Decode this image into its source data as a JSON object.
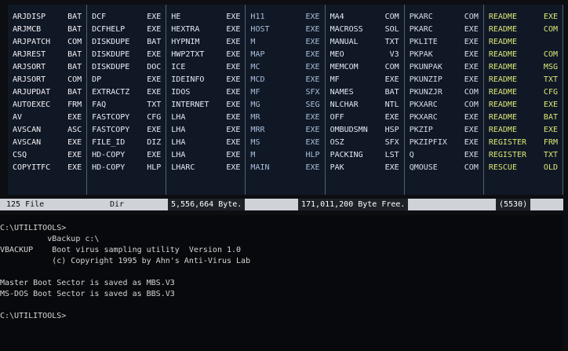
{
  "file_columns": [
    {
      "color": "#f4f1f5",
      "files": [
        [
          "ARJDISP",
          "BAT"
        ],
        [
          "ARJMCB",
          "BAT"
        ],
        [
          "ARJPATCH",
          "COM"
        ],
        [
          "ARJREST",
          "BAT"
        ],
        [
          "ARJSORT",
          "BAT"
        ],
        [
          "ARJSORT",
          "COM"
        ],
        [
          "ARJUPDAT",
          "BAT"
        ],
        [
          "AUTOEXEC",
          "FRM"
        ],
        [
          "AV",
          "EXE"
        ],
        [
          "AVSCAN",
          "ASC"
        ],
        [
          "AVSCAN",
          "EXE"
        ],
        [
          "CSQ",
          "EXE"
        ],
        [
          "COPYITFC",
          "EXE"
        ]
      ]
    },
    {
      "color": "#e9ecf5",
      "files": [
        [
          "DCF",
          "EXE"
        ],
        [
          "DCFHELP",
          "EXE"
        ],
        [
          "DISKDUPE",
          "BAT"
        ],
        [
          "DISKDUPE",
          "EXE"
        ],
        [
          "DISKDUPE",
          "DOC"
        ],
        [
          "DP",
          "EXE"
        ],
        [
          "EXTRACTZ",
          "EXE"
        ],
        [
          "FAQ",
          "TXT"
        ],
        [
          "FASTCOPY",
          "CFG"
        ],
        [
          "FASTCOPY",
          "EXE"
        ],
        [
          "FILE_ID",
          "DIZ"
        ],
        [
          "HD-COPY",
          "EXE"
        ],
        [
          "HD-COPY",
          "HLP"
        ]
      ]
    },
    {
      "color": "#e4e8f2",
      "files": [
        [
          "HE",
          "EXE"
        ],
        [
          "HEXTRA",
          "EXE"
        ],
        [
          "HYPNIM",
          "EXE"
        ],
        [
          "HWP2TXT",
          "EXE"
        ],
        [
          "ICE",
          "EXE"
        ],
        [
          "IDEINFO",
          "EXE"
        ],
        [
          "IDOS",
          "EXE"
        ],
        [
          "INTERNET",
          "EXE"
        ],
        [
          "LHA",
          "EXE"
        ],
        [
          "LHA",
          "EXE"
        ],
        [
          "LHA",
          "EXE"
        ],
        [
          "LHA",
          "EXE"
        ],
        [
          "LHARC",
          "EXE"
        ]
      ]
    },
    {
      "color": "#a9bfd9",
      "files": [
        [
          "H11",
          "EXE"
        ],
        [
          "HOST",
          "EXE"
        ],
        [
          "M",
          "EXE"
        ],
        [
          "MAP",
          "EXE"
        ],
        [
          "MC",
          "EXE"
        ],
        [
          "MCD",
          "EXE"
        ],
        [
          "MF",
          "SFX"
        ],
        [
          "MG",
          "SEG"
        ],
        [
          "MR",
          "EXE"
        ],
        [
          "MRR",
          "EXE"
        ],
        [
          "MS",
          "EXE"
        ],
        [
          "M",
          "HLP"
        ],
        [
          "MAIN",
          "EXE"
        ]
      ]
    },
    {
      "color": "#e2e7f0",
      "files": [
        [
          "MA4",
          "COM"
        ],
        [
          "MACROSS",
          "SOL"
        ],
        [
          "MANUAL",
          "TXT"
        ],
        [
          "MEO",
          "V3"
        ],
        [
          "MEMCOM",
          "COM"
        ],
        [
          "MF",
          "EXE"
        ],
        [
          "NAMES",
          "BAT"
        ],
        [
          "NLCHAR",
          "NTL"
        ],
        [
          "OFF",
          "EXE"
        ],
        [
          "OMBUDSMN",
          "HSP"
        ],
        [
          "OSZ",
          "SFX"
        ],
        [
          "PACKING",
          "LST"
        ],
        [
          "PAK",
          "EXE"
        ]
      ]
    },
    {
      "color": "#d9dde8",
      "files": [
        [
          "PKARC",
          "COM"
        ],
        [
          "PKARC",
          "EXE"
        ],
        [
          "PKLITE",
          "EXE"
        ],
        [
          "PKPAK",
          "EXE"
        ],
        [
          "PKUNPAK",
          "EXE"
        ],
        [
          "PKUNZIP",
          "EXE"
        ],
        [
          "PKUNZJR",
          "COM"
        ],
        [
          "PKXARC",
          "COM"
        ],
        [
          "PKXARC",
          "EXE"
        ],
        [
          "PKZIP",
          "EXE"
        ],
        [
          "PKZIPFIX",
          "EXE"
        ],
        [
          "Q",
          "EXE"
        ],
        [
          "QMOUSE",
          "COM"
        ]
      ]
    },
    {
      "color": "#dce775",
      "files": [
        [
          "README",
          "EXE"
        ],
        [
          "README",
          "COM"
        ],
        [
          "README",
          ""
        ],
        [
          "README",
          "COM"
        ],
        [
          "README",
          "MSG"
        ],
        [
          "README",
          "TXT"
        ],
        [
          "README",
          "CFG"
        ],
        [
          "README",
          "EXE"
        ],
        [
          "README",
          "BAT"
        ],
        [
          "README",
          "EXE"
        ],
        [
          "REGISTER",
          "FRM"
        ],
        [
          "REGISTER",
          "TXT"
        ],
        [
          "RESCUE",
          "OLD"
        ]
      ]
    }
  ],
  "statusbar": {
    "left": "125 File",
    "dir": "Dir",
    "bytes": "5,556,664 Byte.",
    "free": "171,011,200 Byte Free.",
    "tail": "(5530)"
  },
  "console": [
    "C:\\UTILITOOLS>",
    "          vBackup c:\\",
    "VBACKUP    Boot virus sampling utility  Version 1.0",
    "           (c) Copyright 1995 by Ahn's Anti-Virus Lab",
    "",
    "Master Boot Sector is saved as MBS.V3",
    "MS-DOS Boot Sector is saved as BBS.V3",
    "",
    "C:\\UTILITOOLS>"
  ]
}
